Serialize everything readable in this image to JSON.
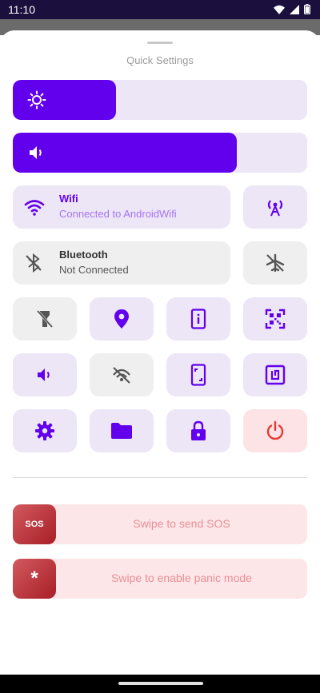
{
  "status_bar": {
    "time": "11:10"
  },
  "sheet": {
    "title": "Quick Settings"
  },
  "sliders": {
    "brightness_level": 0.35,
    "volume_level": 0.76
  },
  "wifi": {
    "title": "Wifi",
    "status": "Connected to AndroidWifi"
  },
  "bluetooth": {
    "title": "Bluetooth",
    "status": "Not Connected"
  },
  "sos": {
    "knob_label": "SOS",
    "label": "Swipe to send SOS"
  },
  "panic": {
    "knob_label": "*",
    "label": "Swipe to enable panic mode"
  },
  "colors": {
    "accent": "#6200ee",
    "tile_active": "#ece6f6",
    "tile_inactive": "#efefef",
    "danger": "#e53935",
    "danger_bg": "#fde3e5"
  }
}
